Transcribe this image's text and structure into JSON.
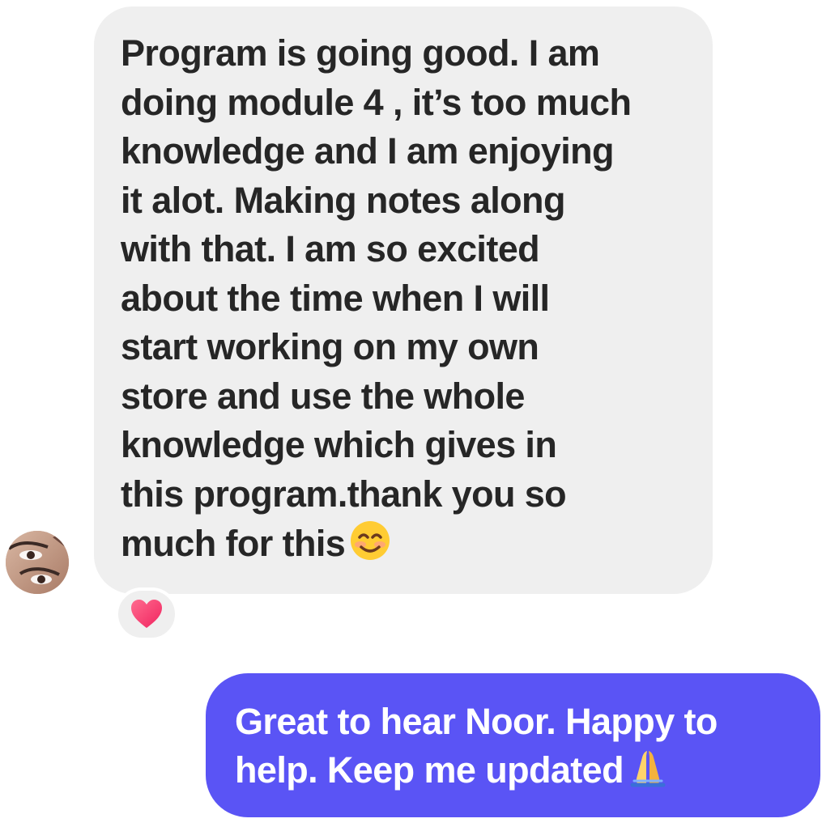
{
  "thread": {
    "incoming_message": {
      "text": "Program is going good. I am\ndoing module 4 , it’s too much\nknowledge and I am enjoying\nit alot. Making notes along\nwith that. I am so excited\nabout the time when I will\nstart working on my own\nstore and use the whole\nknowledge which gives in\nthis program.thank you so\nmuch for this",
      "emoji": "smiling-face-emoji",
      "reaction": "heart-reaction",
      "bubble_color": "#efefef",
      "text_color": "#262626"
    },
    "outgoing_message": {
      "text": "Great to hear Noor. Happy to\nhelp. Keep me updated",
      "emoji": "folded-hands-emoji",
      "bubble_color": "#5a54f5",
      "text_color": "#ffffff"
    }
  }
}
